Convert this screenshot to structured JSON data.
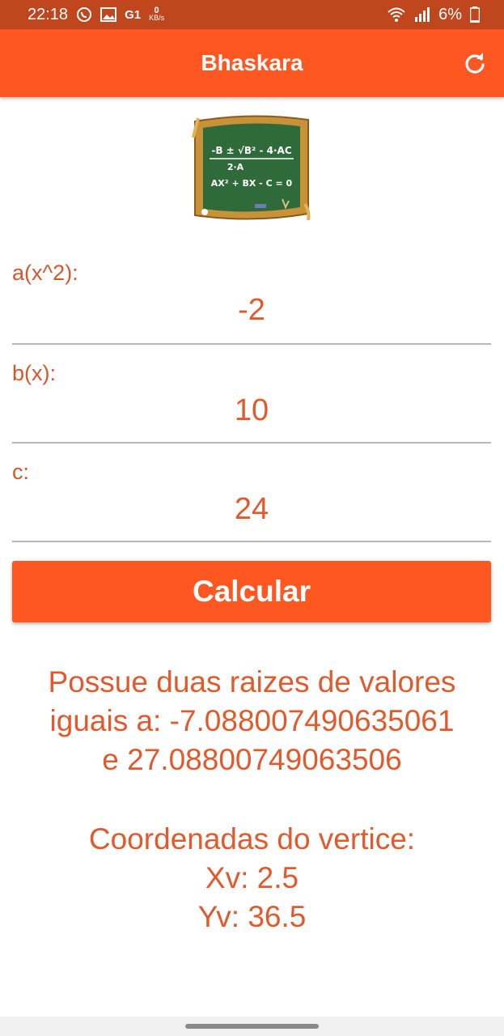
{
  "status_bar": {
    "time": "22:18",
    "net_speed_value": "0",
    "net_speed_unit": "KB/s",
    "battery": "6%",
    "icons": [
      "whatsapp-icon",
      "gallery-icon",
      "g1-icon",
      "wifi-icon",
      "signal-icon",
      "battery-icon"
    ],
    "g1_label": "G1"
  },
  "app_bar": {
    "title": "Bhaskara",
    "refresh_icon": "refresh-icon"
  },
  "logo": {
    "line1": "-B ± √B² - 4·AC",
    "line2": "2·A",
    "line3": "AX² + BX - C = 0"
  },
  "fields": [
    {
      "label": "a(x^2):",
      "value": "-2"
    },
    {
      "label": "b(x):",
      "value": "10"
    },
    {
      "label": "c:",
      "value": "24"
    }
  ],
  "calculate_button": "Calcular",
  "result": {
    "roots_line1": "Possue duas raizes de valores",
    "roots_line2": "iguais a: -7.088007490635061",
    "roots_line3": "e 27.08800749063506",
    "vertex_title": "Coordenadas do vertice:",
    "xv": "Xv: 2.5",
    "yv": "Yv: 36.5"
  },
  "colors": {
    "status_bar": "#c0461d",
    "primary": "#ff5722",
    "text_accent": "#e25a2b"
  }
}
